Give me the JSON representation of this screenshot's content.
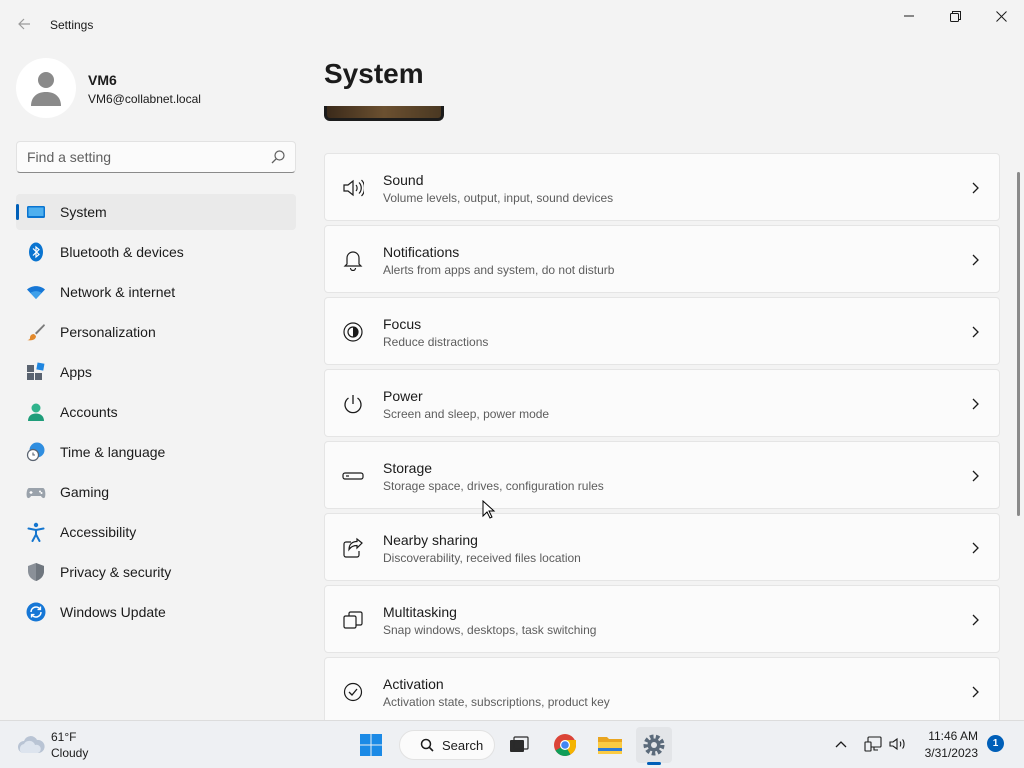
{
  "window": {
    "title": "Settings"
  },
  "profile": {
    "name": "VM6",
    "email": "VM6@collabnet.local"
  },
  "search": {
    "placeholder": "Find a setting"
  },
  "sidebar": {
    "items": [
      {
        "label": "System",
        "icon": "system-icon",
        "active": true
      },
      {
        "label": "Bluetooth & devices",
        "icon": "bluetooth-icon"
      },
      {
        "label": "Network & internet",
        "icon": "wifi-icon"
      },
      {
        "label": "Personalization",
        "icon": "brush-icon"
      },
      {
        "label": "Apps",
        "icon": "apps-icon"
      },
      {
        "label": "Accounts",
        "icon": "accounts-icon"
      },
      {
        "label": "Time & language",
        "icon": "globe-clock-icon"
      },
      {
        "label": "Gaming",
        "icon": "gamepad-icon"
      },
      {
        "label": "Accessibility",
        "icon": "accessibility-icon"
      },
      {
        "label": "Privacy & security",
        "icon": "shield-icon"
      },
      {
        "label": "Windows Update",
        "icon": "update-icon"
      }
    ]
  },
  "main": {
    "title": "System",
    "cards": [
      {
        "title": "Sound",
        "subtitle": "Volume levels, output, input, sound devices",
        "icon": "speaker-icon"
      },
      {
        "title": "Notifications",
        "subtitle": "Alerts from apps and system, do not disturb",
        "icon": "bell-icon"
      },
      {
        "title": "Focus",
        "subtitle": "Reduce distractions",
        "icon": "focus-icon"
      },
      {
        "title": "Power",
        "subtitle": "Screen and sleep, power mode",
        "icon": "power-icon"
      },
      {
        "title": "Storage",
        "subtitle": "Storage space, drives, configuration rules",
        "icon": "storage-icon"
      },
      {
        "title": "Nearby sharing",
        "subtitle": "Discoverability, received files location",
        "icon": "share-icon"
      },
      {
        "title": "Multitasking",
        "subtitle": "Snap windows, desktops, task switching",
        "icon": "multitask-icon"
      },
      {
        "title": "Activation",
        "subtitle": "Activation state, subscriptions, product key",
        "icon": "check-circle-icon"
      }
    ]
  },
  "taskbar": {
    "weather": {
      "temp": "61°F",
      "condition": "Cloudy"
    },
    "search_label": "Search",
    "clock": {
      "time": "11:46 AM",
      "date": "3/31/2023"
    },
    "notifications_count": "1"
  },
  "colors": {
    "accent": "#005fb8",
    "background": "#f3f3f3",
    "card": "#fbfbfb"
  }
}
